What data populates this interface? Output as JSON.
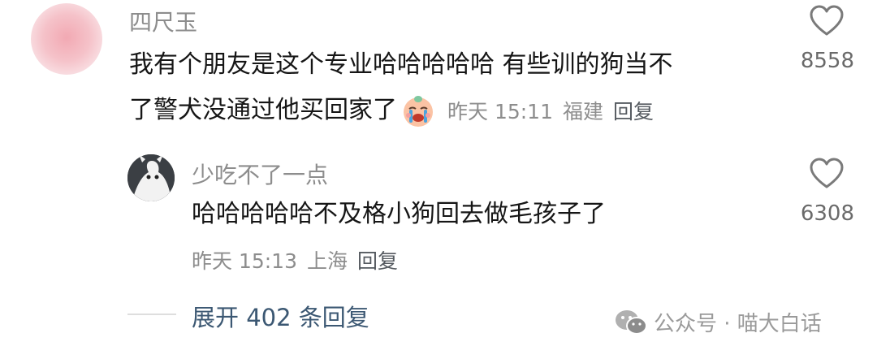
{
  "comment": {
    "author": "四尺玉",
    "text_line1": "我有个朋友是这个专业哈哈哈哈哈 有些训的狗当不",
    "text_line2": "了警犬没通过他买回家了",
    "time": "昨天 15:11",
    "location": "福建",
    "reply_label": "回复",
    "likes": "8558",
    "emoji": "crying-face-emoji"
  },
  "reply": {
    "author": "少吃不了一点",
    "text": "哈哈哈哈哈不及格小狗回去做毛孩子了",
    "time": "昨天 15:13",
    "location": "上海",
    "reply_label": "回复",
    "likes": "6308"
  },
  "expand_replies": "展开 402 条回复",
  "watermark": {
    "icon": "wechat-icon",
    "text": "公众号 · 喵大白话"
  },
  "colors": {
    "name": "#8d8d8d",
    "body": "#161616",
    "link": "#3c5873"
  }
}
